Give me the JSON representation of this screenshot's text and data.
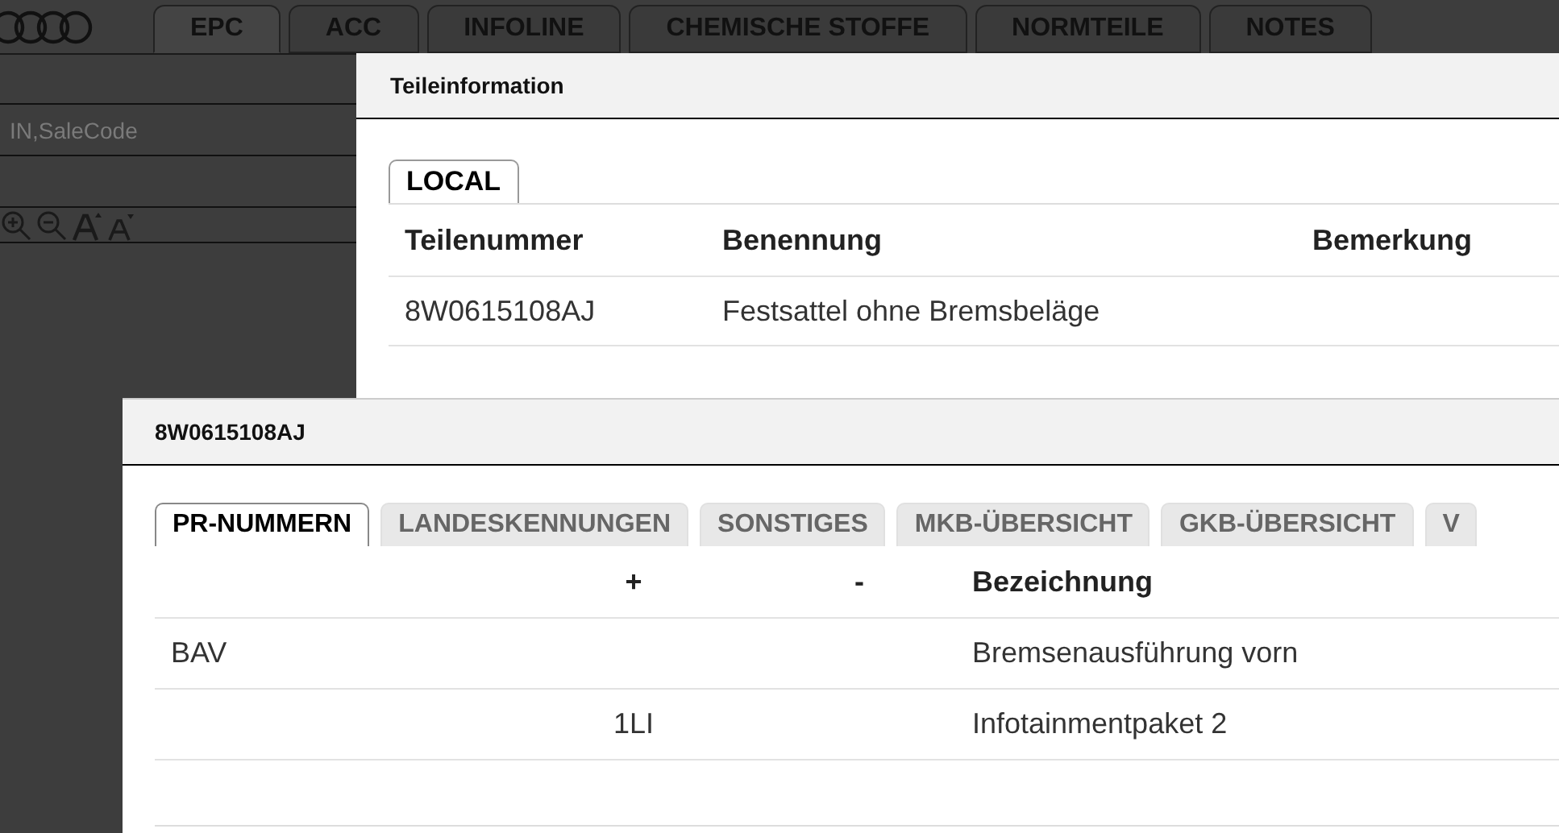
{
  "top_tabs": [
    {
      "label": "EPC",
      "selected": true
    },
    {
      "label": "ACC",
      "selected": false
    },
    {
      "label": "INFOLINE",
      "selected": false
    },
    {
      "label": "CHEMISCHE STOFFE",
      "selected": false
    },
    {
      "label": "NORMTEILE",
      "selected": false
    },
    {
      "label": "NOTES",
      "selected": false
    }
  ],
  "search": {
    "placeholder": "IN,SaleCode"
  },
  "part_dialog": {
    "title": "Teileinformation",
    "tabs": [
      {
        "label": "LOCAL",
        "selected": true
      }
    ],
    "columns": [
      "Teilenummer",
      "Benennung",
      "Bemerkung"
    ],
    "rows": [
      [
        "8W0615108AJ",
        "Festsattel ohne Bremsbeläge",
        ""
      ]
    ]
  },
  "pr_dialog": {
    "title": "8W0615108AJ",
    "tabs": [
      {
        "label": "PR-NUMMERN",
        "selected": true
      },
      {
        "label": "LANDESKENNUNGEN",
        "selected": false
      },
      {
        "label": "SONSTIGES",
        "selected": false
      },
      {
        "label": "MKB-ÜBERSICHT",
        "selected": false
      },
      {
        "label": "GKB-ÜBERSICHT",
        "selected": false
      },
      {
        "label": "V",
        "selected": false
      }
    ],
    "columns": [
      "",
      "+",
      "-",
      "Bezeichnung"
    ],
    "rows": [
      [
        "BAV",
        "",
        "",
        "Bremsenausführung vorn"
      ],
      [
        "",
        "1LI",
        "",
        "Infotainmentpaket 2"
      ]
    ]
  }
}
